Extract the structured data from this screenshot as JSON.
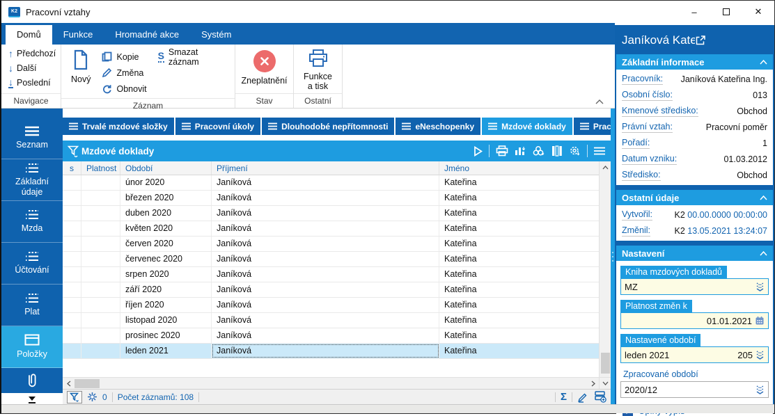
{
  "colors": {
    "dark_blue": "#0F62AE",
    "light_blue": "#1E9CE0",
    "accent_red": "#EC6B6B",
    "selection": "#CBE9F9",
    "input_yellow": "#FDFCE4"
  },
  "titlebar": {
    "logo": "K2",
    "title": "Pracovní vztahy"
  },
  "ribbon": {
    "tabs": [
      {
        "label": "Domů",
        "active": true
      },
      {
        "label": "Funkce",
        "active": false
      },
      {
        "label": "Hromadné akce",
        "active": false
      },
      {
        "label": "Systém",
        "active": false
      }
    ],
    "navigace": {
      "label": "Navigace",
      "predchozi": "Předchozí",
      "dalsi": "Další",
      "posledni": "Poslední"
    },
    "zaznam": {
      "label": "Záznam",
      "novy": "Nový",
      "kopie": "Kopie",
      "zmena": "Změna",
      "obnovit": "Obnovit",
      "smazat": "Smazat záznam",
      "smazat_glyph": "S"
    },
    "stav": {
      "label": "Stav",
      "zneplatneni": "Zneplatnění"
    },
    "ostatni": {
      "label": "Ostatní",
      "funkce_tisk": "Funkce a tisk"
    }
  },
  "sidebar": {
    "items": [
      {
        "label": "Seznam",
        "active": false
      },
      {
        "label": "Základní údaje",
        "active": false
      },
      {
        "label": "Mzda",
        "active": false
      },
      {
        "label": "Účtování",
        "active": false
      },
      {
        "label": "Plat",
        "active": false
      },
      {
        "label": "Položky",
        "active": true
      }
    ]
  },
  "tabstrip": {
    "tabs": [
      {
        "label": "Trvalé mzdové složky",
        "active": false
      },
      {
        "label": "Pracovní úkoly",
        "active": false
      },
      {
        "label": "Dlouhodobé nepřítomnosti",
        "active": false
      },
      {
        "label": "eNeschopenky",
        "active": false
      },
      {
        "label": "Mzdové doklady",
        "active": true
      },
      {
        "label": "Pracovní praxe",
        "active": false
      }
    ]
  },
  "grid": {
    "title": "Mzdové doklady",
    "columns": [
      "s",
      "Platnost",
      "Období",
      "Příjmení",
      "Jméno"
    ],
    "rows": [
      [
        "únor 2020",
        "Janíková",
        "Kateřina"
      ],
      [
        "březen 2020",
        "Janíková",
        "Kateřina"
      ],
      [
        "duben 2020",
        "Janíková",
        "Kateřina"
      ],
      [
        "květen 2020",
        "Janíková",
        "Kateřina"
      ],
      [
        "červen 2020",
        "Janíková",
        "Kateřina"
      ],
      [
        "červenec 2020",
        "Janíková",
        "Kateřina"
      ],
      [
        "srpen 2020",
        "Janíková",
        "Kateřina"
      ],
      [
        "září 2020",
        "Janíková",
        "Kateřina"
      ],
      [
        "říjen 2020",
        "Janíková",
        "Kateřina"
      ],
      [
        "listopad 2020",
        "Janíková",
        "Kateřina"
      ],
      [
        "prosinec 2020",
        "Janíková",
        "Kateřina"
      ],
      [
        "leden 2021",
        "Janíková",
        "Kateřina"
      ]
    ],
    "selected_row": 11
  },
  "statusbar": {
    "frozen_count": "0",
    "record_count": "Počet záznamů: 108"
  },
  "inspector": {
    "title": "Janíková Kateřina I...",
    "zakladni": {
      "header": "Základní informace",
      "fields": [
        {
          "label": "Pracovník:",
          "value": "Janíková Kateřina Ing."
        },
        {
          "label": "Osobní číslo:",
          "value": "013"
        },
        {
          "label": "Kmenové středisko:",
          "value": "Obchod"
        },
        {
          "label": "Právní vztah:",
          "value": "Pracovní poměr"
        },
        {
          "label": "Pořadí:",
          "value": "1"
        },
        {
          "label": "Datum vzniku:",
          "value": "01.03.2012"
        },
        {
          "label": "Středisko:",
          "value": "Obchod"
        }
      ]
    },
    "ostatni": {
      "header": "Ostatní údaje",
      "fields": [
        {
          "label": "Vytvořil:",
          "user": "K2",
          "datetime": "00.00.0000 00:00:00"
        },
        {
          "label": "Změnil:",
          "user": "K2",
          "datetime": "13.05.2021 13:24:07"
        }
      ]
    },
    "nastaveni": {
      "header": "Nastavení",
      "kniha": {
        "label": "Kniha mzdových dokladů",
        "value": "MZ"
      },
      "platnost": {
        "label": "Platnost změn k",
        "value": "01.01.2021"
      },
      "obdobi": {
        "label": "Nastavené období",
        "value": "leden 2021",
        "number": "205"
      },
      "zpracovane": {
        "label": "Zpracované období",
        "value": "2020/12"
      },
      "uplny_vypis": {
        "label": "Úplný výpis",
        "checked": true
      }
    }
  }
}
